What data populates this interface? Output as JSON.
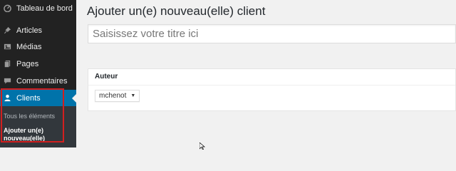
{
  "sidebar": {
    "items": [
      {
        "label": "Tableau de bord",
        "icon": "dashboard-icon"
      },
      {
        "label": "Articles",
        "icon": "pin-icon"
      },
      {
        "label": "Médias",
        "icon": "media-icon"
      },
      {
        "label": "Pages",
        "icon": "pages-icon"
      },
      {
        "label": "Commentaires",
        "icon": "comment-icon"
      },
      {
        "label": "Clients",
        "icon": "user-icon",
        "active": true
      }
    ],
    "submenu": [
      {
        "label": "Tous les éléments"
      },
      {
        "label": "Ajouter un(e) nouveau(elle)",
        "current": true
      }
    ],
    "active_color": "#0073aa",
    "highlight_color": "#d21f1f"
  },
  "main": {
    "title": "Ajouter un(e) nouveau(elle) client",
    "title_placeholder": "Saisissez votre titre ici",
    "author_box": {
      "heading": "Auteur",
      "selected": "mchenot"
    }
  }
}
